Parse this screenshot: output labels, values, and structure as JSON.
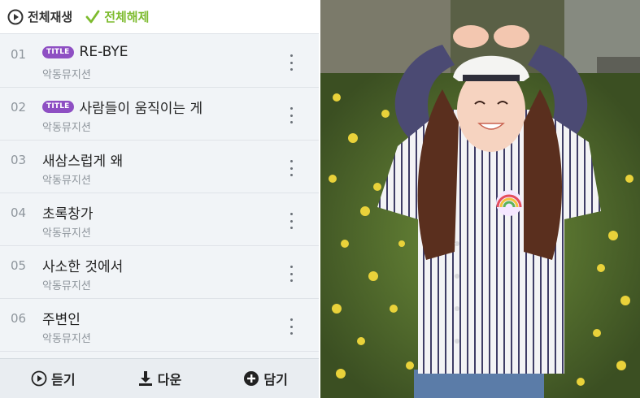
{
  "topbar": {
    "play_all_label": "전체재생",
    "deselect_all_label": "전체해제"
  },
  "tracks": [
    {
      "number": "01",
      "badge": "TITLE",
      "title": "RE-BYE",
      "artist": "악동뮤지션"
    },
    {
      "number": "02",
      "badge": "TITLE",
      "title": "사람들이 움직이는 게",
      "artist": "악동뮤지션"
    },
    {
      "number": "03",
      "badge": "",
      "title": "새삼스럽게 왜",
      "artist": "악동뮤지션"
    },
    {
      "number": "04",
      "badge": "",
      "title": "초록창가",
      "artist": "악동뮤지션"
    },
    {
      "number": "05",
      "badge": "",
      "title": "사소한 것에서",
      "artist": "악동뮤지션"
    },
    {
      "number": "06",
      "badge": "",
      "title": "주변인",
      "artist": "악동뮤지션"
    }
  ],
  "bottombar": {
    "listen_label": "듣기",
    "download_label": "다운",
    "add_label": "담기"
  },
  "icons": {
    "play": "play-circle-icon",
    "check": "check-icon",
    "more": "more-vertical-icon",
    "download": "download-icon",
    "add": "plus-circle-icon"
  },
  "colors": {
    "accent_green": "#7dbb2e",
    "badge_purple": "#8e4fc3",
    "list_bg": "#f1f4f7"
  }
}
